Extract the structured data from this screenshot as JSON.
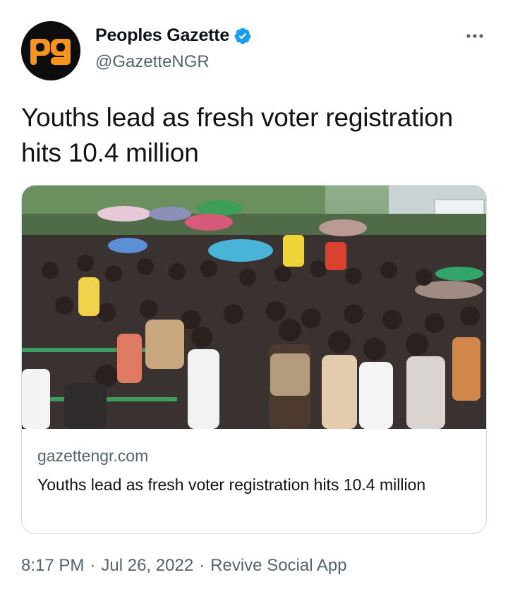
{
  "author": {
    "display_name": "Peoples Gazette",
    "handle": "@GazetteNGR",
    "avatar_text": "pg",
    "verified": true
  },
  "icons": {
    "verified": "verified-badge-icon",
    "more": "more-horizontal-icon"
  },
  "tweet": {
    "text": "Youths lead as fresh voter registration hits 10.4 million"
  },
  "card": {
    "image_description": "crowd",
    "domain": "gazettengr.com",
    "title": "Youths lead as fresh voter registration hits 10.4 million"
  },
  "meta": {
    "time": "8:17 PM",
    "date": "Jul 26, 2022",
    "source": "Revive Social App",
    "separator": "·"
  },
  "colors": {
    "brand_orange": "#f7941d",
    "verified_blue": "#1d9bf0",
    "secondary_text": "#536471",
    "border": "#cfd9de"
  }
}
